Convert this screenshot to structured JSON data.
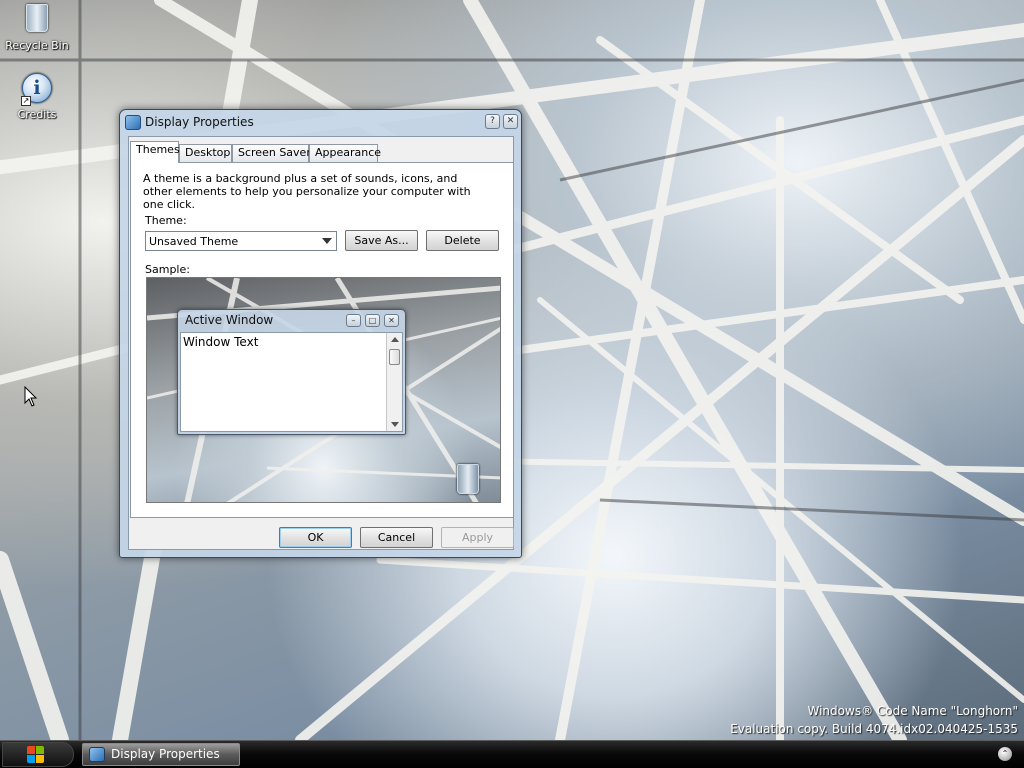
{
  "desktop": {
    "icons": [
      {
        "label": "Recycle Bin",
        "icon": "recycle-bin-icon"
      },
      {
        "label": "Credits",
        "icon": "info-icon"
      }
    ],
    "watermark": {
      "line1": "Windows® Code Name \"Longhorn\"",
      "line2": "Evaluation copy. Build 4074.idx02.040425-1535"
    }
  },
  "dialog": {
    "title": "Display Properties",
    "app_icon": "display-properties-icon",
    "title_buttons": {
      "help": "?",
      "close": "✕"
    },
    "tabs": [
      {
        "label": "Themes",
        "active": true
      },
      {
        "label": "Desktop",
        "active": false
      },
      {
        "label": "Screen Saver",
        "active": false
      },
      {
        "label": "Appearance",
        "active": false
      }
    ],
    "themes_panel": {
      "description": "A theme is a background plus a set of sounds, icons, and other elements to help you personalize your computer with one click.",
      "theme_label": "Theme:",
      "theme_value": "Unsaved Theme",
      "save_as_label": "Save As...",
      "delete_label": "Delete",
      "sample_label": "Sample:",
      "sample_window": {
        "title": "Active Window",
        "body_text": "Window Text",
        "buttons": {
          "minimize": "–",
          "maximize": "□",
          "close": "✕"
        }
      }
    },
    "footer_buttons": {
      "ok": "OK",
      "cancel": "Cancel",
      "apply": "Apply"
    }
  },
  "taskbar": {
    "start_icon": "windows-flag-icon",
    "tasks": [
      {
        "label": "Display Properties",
        "icon": "display-properties-icon"
      }
    ],
    "tray_icon": "tray-expand-icon",
    "tray_glyph": "⌃"
  },
  "colors": {
    "window_frame": "#c4d6e8",
    "default_button_border": "#3c7fb1",
    "taskbar": "#0a0a0a"
  }
}
